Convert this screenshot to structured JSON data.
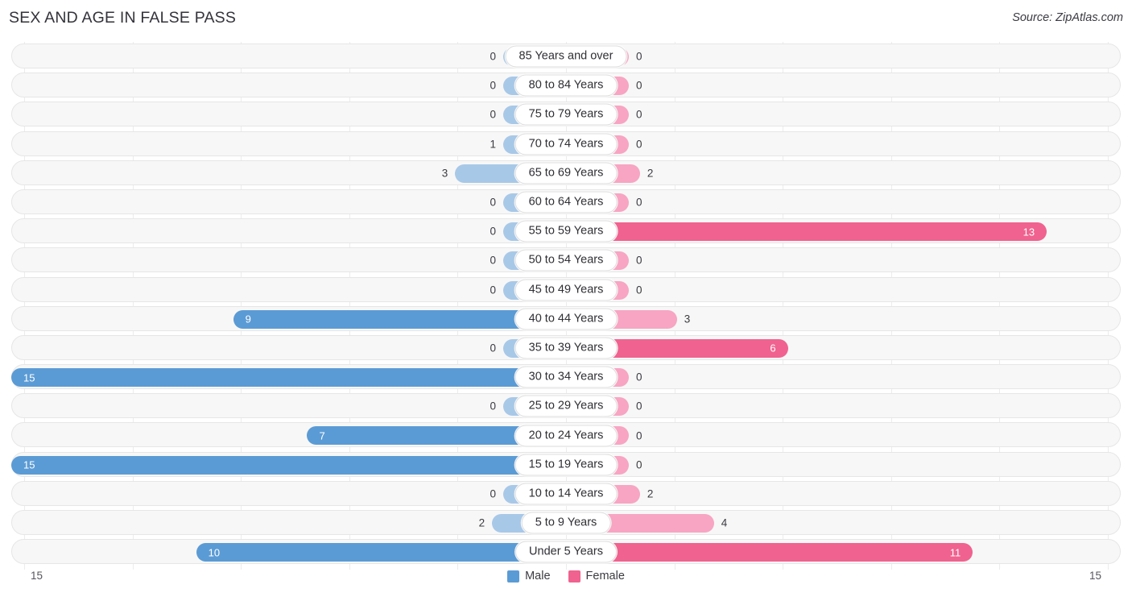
{
  "header": {
    "title": "SEX AND AGE IN FALSE PASS",
    "source": "Source: ZipAtlas.com"
  },
  "colors": {
    "male_strong": "#5b9bd5",
    "male_light": "#a8c8e8",
    "female_strong": "#f0628f",
    "female_light": "#f7a5c2",
    "track": "#f7f7f7",
    "gridline": "#ececec",
    "text": "#3b3b42"
  },
  "legend": {
    "items": [
      {
        "label": "Male",
        "color": "#5b9bd5",
        "swatch_name": "legend-swatch-male"
      },
      {
        "label": "Female",
        "color": "#f0628f",
        "swatch_name": "legend-swatch-female"
      }
    ]
  },
  "axis": {
    "left_label": "15",
    "right_label": "15",
    "max": 15,
    "min_bar_display": 2.6
  },
  "chart_data": {
    "type": "bar",
    "orientation": "horizontal-diverging",
    "title": "SEX AND AGE IN FALSE PASS",
    "subtitle": "",
    "xlabel": "",
    "ylabel": "",
    "xlim": [
      15,
      15
    ],
    "grid": true,
    "legend_position": "bottom-center",
    "categories": [
      "85 Years and over",
      "80 to 84 Years",
      "75 to 79 Years",
      "70 to 74 Years",
      "65 to 69 Years",
      "60 to 64 Years",
      "55 to 59 Years",
      "50 to 54 Years",
      "45 to 49 Years",
      "40 to 44 Years",
      "35 to 39 Years",
      "30 to 34 Years",
      "25 to 29 Years",
      "20 to 24 Years",
      "15 to 19 Years",
      "10 to 14 Years",
      "5 to 9 Years",
      "Under 5 Years"
    ],
    "series": [
      {
        "name": "Male",
        "values": [
          0,
          0,
          0,
          1,
          3,
          0,
          0,
          0,
          0,
          9,
          0,
          15,
          0,
          7,
          15,
          0,
          2,
          10
        ]
      },
      {
        "name": "Female",
        "values": [
          0,
          0,
          0,
          0,
          2,
          0,
          13,
          0,
          0,
          3,
          6,
          0,
          0,
          0,
          0,
          2,
          4,
          11
        ]
      }
    ]
  },
  "rows": [
    {
      "label": "85 Years and over",
      "male": 0,
      "female": 0
    },
    {
      "label": "80 to 84 Years",
      "male": 0,
      "female": 0
    },
    {
      "label": "75 to 79 Years",
      "male": 0,
      "female": 0
    },
    {
      "label": "70 to 74 Years",
      "male": 1,
      "female": 0
    },
    {
      "label": "65 to 69 Years",
      "male": 3,
      "female": 2
    },
    {
      "label": "60 to 64 Years",
      "male": 0,
      "female": 0
    },
    {
      "label": "55 to 59 Years",
      "male": 0,
      "female": 13
    },
    {
      "label": "50 to 54 Years",
      "male": 0,
      "female": 0
    },
    {
      "label": "45 to 49 Years",
      "male": 0,
      "female": 0
    },
    {
      "label": "40 to 44 Years",
      "male": 9,
      "female": 3
    },
    {
      "label": "35 to 39 Years",
      "male": 0,
      "female": 6
    },
    {
      "label": "30 to 34 Years",
      "male": 15,
      "female": 0
    },
    {
      "label": "25 to 29 Years",
      "male": 0,
      "female": 0
    },
    {
      "label": "20 to 24 Years",
      "male": 7,
      "female": 0
    },
    {
      "label": "15 to 19 Years",
      "male": 15,
      "female": 0
    },
    {
      "label": "10 to 14 Years",
      "male": 0,
      "female": 2
    },
    {
      "label": "5 to 9 Years",
      "male": 2,
      "female": 4
    },
    {
      "label": "Under 5 Years",
      "male": 10,
      "female": 11
    }
  ]
}
